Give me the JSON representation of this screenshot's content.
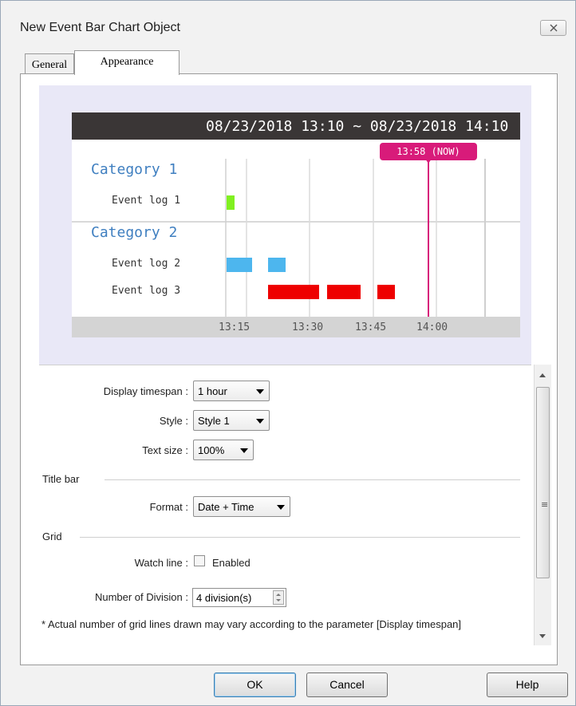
{
  "window": {
    "title": "New Event Bar Chart Object"
  },
  "tabs": [
    {
      "label": "General"
    },
    {
      "label": "Appearance"
    }
  ],
  "preview": {
    "title_bar_text": "08/23/2018 13:10 ~ 08/23/2018 14:10",
    "now_label": "13:58 (NOW)",
    "categories": [
      {
        "label": "Category 1",
        "events": [
          "Event log 1"
        ]
      },
      {
        "label": "Category 2",
        "events": [
          "Event log 2",
          "Event log 3"
        ]
      }
    ],
    "time_ticks": [
      "13:15",
      "13:30",
      "13:45",
      "14:00"
    ],
    "colors": {
      "event_log_1": "#80f020",
      "event_log_2": "#4db6ee",
      "event_log_3": "#ee0000",
      "now_line": "#d81b7a",
      "category_text": "#3f7fc0"
    }
  },
  "settings": {
    "display_timespan": {
      "label": "Display timespan :",
      "value": "1 hour"
    },
    "style": {
      "label": "Style :",
      "value": "Style 1"
    },
    "text_size": {
      "label": "Text size :",
      "value": "100%"
    },
    "title_bar_group": "Title bar",
    "format": {
      "label": "Format :",
      "value": "Date + Time"
    },
    "grid_group": "Grid",
    "watch_line": {
      "label": "Watch line :",
      "checkbox_label": "Enabled",
      "checked": false
    },
    "number_of_division": {
      "label": "Number of Division :",
      "value": "4 division(s)"
    },
    "note": "* Actual number of grid lines drawn may vary according to the parameter [Display timespan]"
  },
  "buttons": {
    "ok": "OK",
    "cancel": "Cancel",
    "help": "Help"
  }
}
